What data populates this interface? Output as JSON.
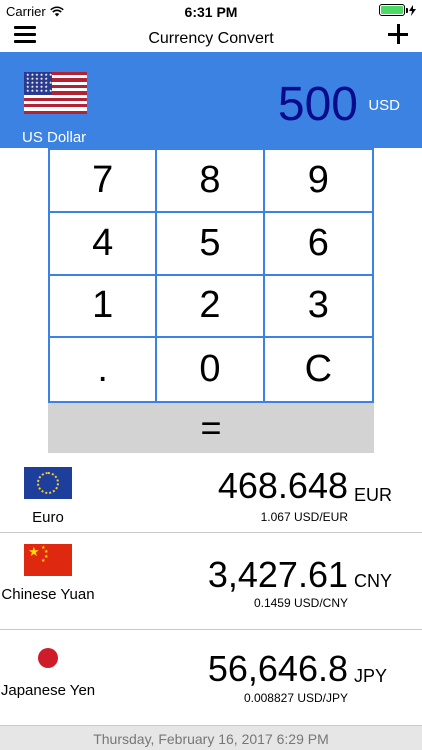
{
  "status": {
    "carrier": "Carrier",
    "time": "6:31 PM"
  },
  "nav": {
    "title": "Currency Convert"
  },
  "base": {
    "name": "US Dollar",
    "amount": "500",
    "code": "USD"
  },
  "keypad": {
    "keys": [
      "7",
      "8",
      "9",
      "4",
      "5",
      "6",
      "1",
      "2",
      "3",
      ".",
      "0",
      "C"
    ],
    "equals": "="
  },
  "currencies": [
    {
      "name": "Euro",
      "value": "468.648",
      "code": "EUR",
      "rate": "1.067 USD/EUR",
      "flag": "eu-flag-icon"
    },
    {
      "name": "Chinese Yuan",
      "value": "3,427.61",
      "code": "CNY",
      "rate": "0.1459 USD/CNY",
      "flag": "cn-flag-icon"
    },
    {
      "name": "Japanese Yen",
      "value": "56,646.8",
      "code": "JPY",
      "rate": "0.008827 USD/JPY",
      "flag": "jp-flag-icon"
    }
  ],
  "footer": {
    "timestamp": "Thursday, February 16, 2017 6:29 PM"
  },
  "colors": {
    "accent": "#3b82e3",
    "amount": "#0a0a8c",
    "battery": "#4cd964"
  }
}
